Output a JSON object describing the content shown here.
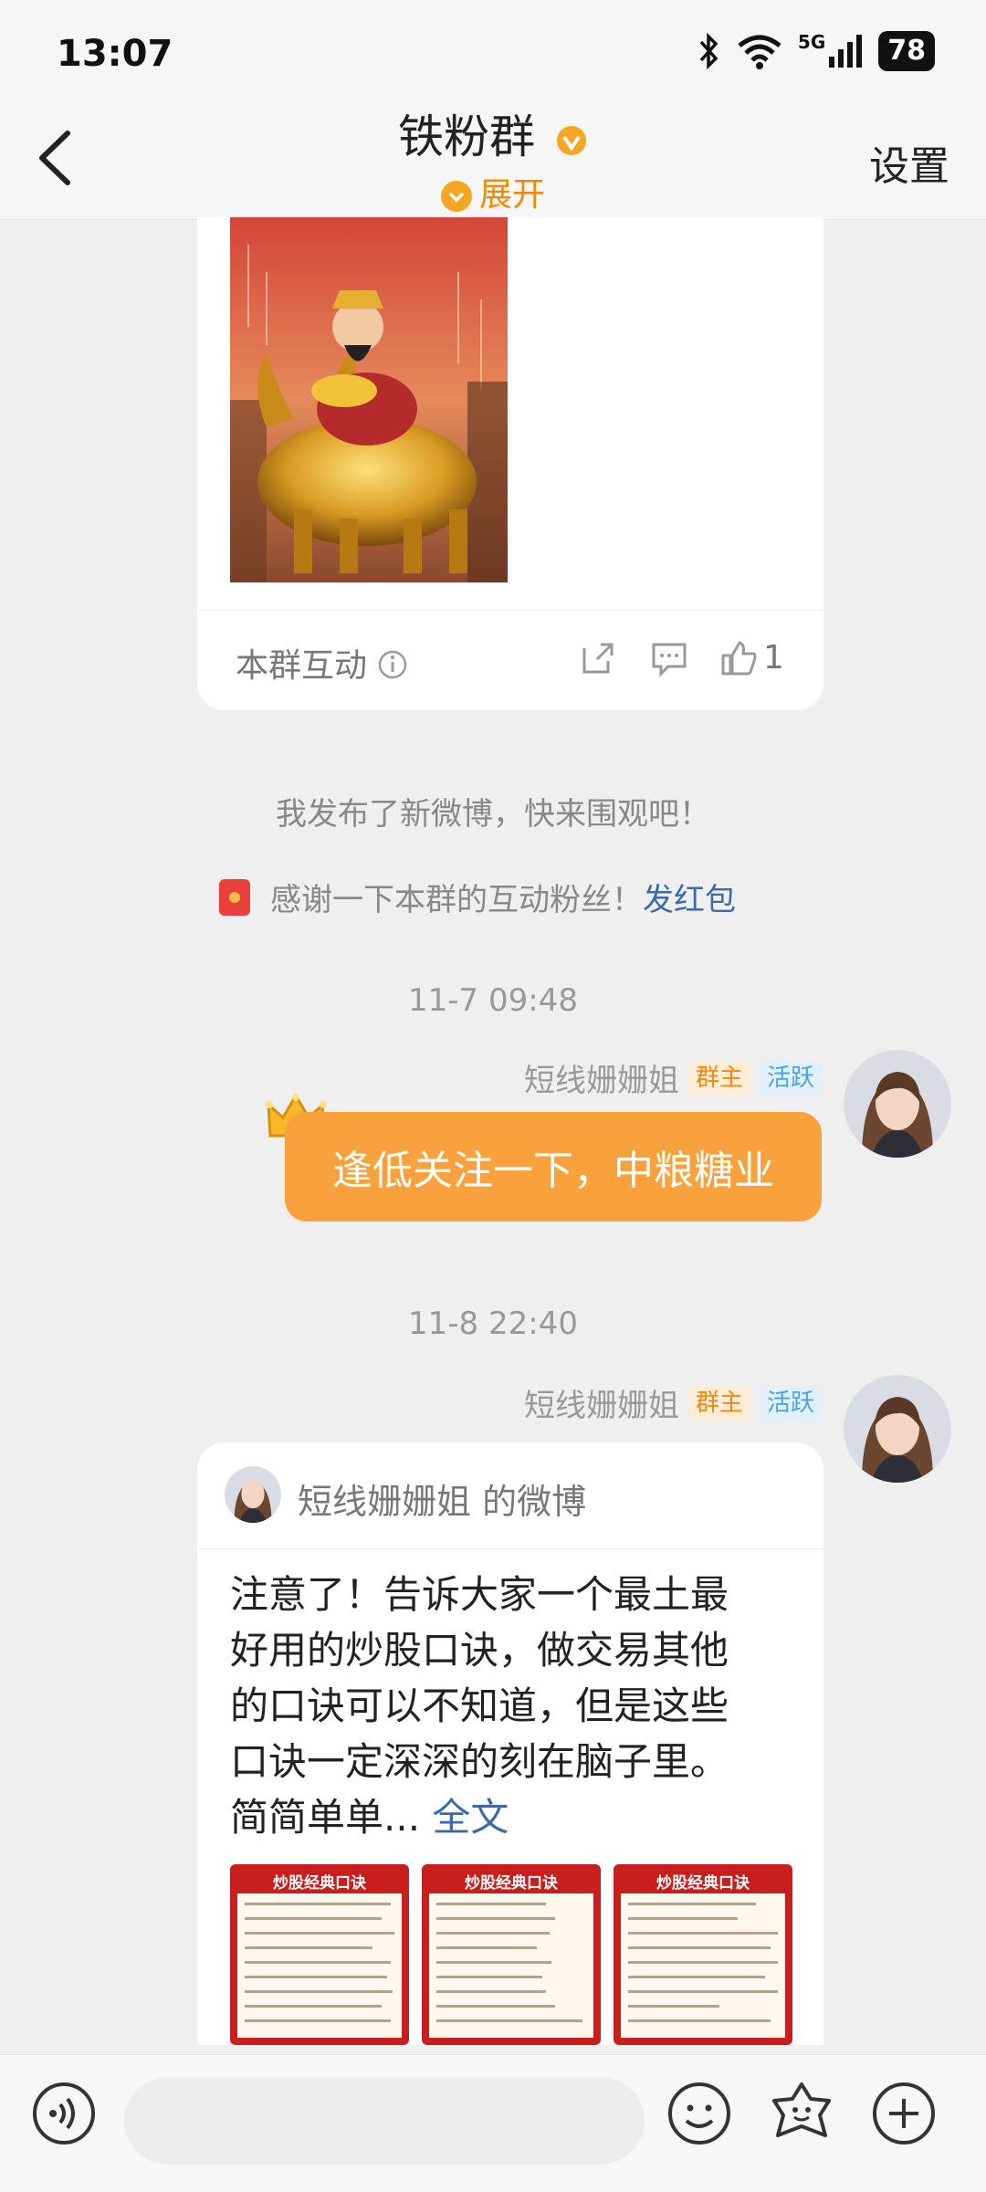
{
  "status": {
    "time": "13:07",
    "network": "5G",
    "battery": "78"
  },
  "header": {
    "title": "铁粉群",
    "expand_label": "展开",
    "settings_label": "设置"
  },
  "post_card": {
    "interaction_label": "本群互动",
    "like_count": "1"
  },
  "system_messages": {
    "new_post": "我发布了新微博，快来围观吧！",
    "thanks": "感谢一下本群的互动粉丝！",
    "red_packet_link": "发红包"
  },
  "timestamps": {
    "first": "11-7 09:48",
    "second": "11-8 22:40"
  },
  "messages": [
    {
      "sender": "短线姗姗姐",
      "tag_owner": "群主",
      "tag_active": "活跃",
      "text": "逢低关注一下，中粮糖业"
    },
    {
      "sender": "短线姗姗姐",
      "tag_owner": "群主",
      "tag_active": "活跃",
      "card_title": "短线姗姗姐 的微博",
      "card_lines": [
        "注意了！告诉大家一个最土最",
        "好用的炒股口诀，做交易其他",
        "的口诀可以不知道，但是这些",
        "口诀一定深深的刻在脑子里。",
        "简简单单..."
      ],
      "card_link": "全文",
      "thumb_titles": [
        "炒股经典口诀",
        "炒股经典口诀",
        "炒股经典口诀"
      ]
    }
  ],
  "icons": [
    "back-icon",
    "verified-badge-icon",
    "share-icon",
    "comment-icon",
    "like-icon",
    "voice-icon",
    "emoji-icon",
    "sticker-icon",
    "plus-icon"
  ],
  "colors": {
    "accent": "#f9a13c",
    "link": "#3b6ba8",
    "owner_tag": "#f08a00",
    "active_tag": "#4aa3df"
  }
}
